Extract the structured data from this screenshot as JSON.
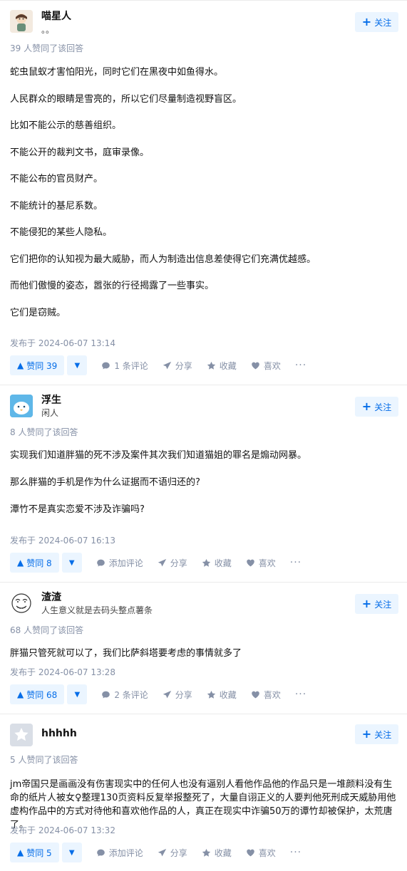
{
  "follow_label": "关注",
  "answers": [
    {
      "author": "喵星人",
      "bio": "。。",
      "vote_text": "39 人赞同了该回答",
      "paragraphs": [
        "蛇虫鼠蚁才害怕阳光，同时它们在黑夜中如鱼得水。",
        "人民群众的眼睛是雪亮的，所以它们尽量制造视野盲区。",
        "比如不能公示的慈善组织。",
        "不能公开的裁判文书，庭审录像。",
        "不能公布的官员财产。",
        "不能统计的基尼系数。",
        "不能侵犯的某些人隐私。",
        "它们把你的认知视为最大威胁，而人为制造出信息差使得它们充满优越感。",
        "而他们傲慢的姿态，嚣张的行径揭露了一些事实。",
        "它们是窃贼。"
      ],
      "time": "发布于 2024-06-07 13:14",
      "upvote": "赞同 39",
      "comment": "1 条评论",
      "share": "分享",
      "collect": "收藏",
      "like": "喜欢",
      "more": "···"
    },
    {
      "author": "浮生",
      "bio": "闲人",
      "vote_text": "8 人赞同了该回答",
      "paragraphs": [
        "实现我们知道胖猫的死不涉及案件其次我们知道猫姐的罪名是煽动网暴。",
        "那么胖猫的手机是作为什么证据而不语归还的?",
        "潭竹不是真实恋爱不涉及诈骗吗?"
      ],
      "time": "发布于 2024-06-07 16:13",
      "upvote": "赞同 8",
      "comment": "添加评论",
      "share": "分享",
      "collect": "收藏",
      "like": "喜欢",
      "more": "···"
    },
    {
      "author": "渣渣",
      "bio": "人生意义就是去码头整点薯条",
      "vote_text": "68 人赞同了该回答",
      "paragraphs": [
        "胖猫只管死就可以了，我们比萨斜塔要考虑的事情就多了"
      ],
      "time": "发布于 2024-06-07 13:28",
      "upvote": "赞同 68",
      "comment": "2 条评论",
      "share": "分享",
      "collect": "收藏",
      "like": "喜欢",
      "more": "···"
    },
    {
      "author": "hhhhh",
      "bio": "",
      "vote_text": "5 人赞同了该回答",
      "paragraphs": [
        "jm帝国只是画画没有伤害现实中的任何人也没有逼别人看他作品他的作品只是一堆颜料没有生命的纸片人被女♀整理130页资料反复举报整死了，大量自诩正义的人要判他死刑成天威胁用他虚构作品中的方式对待他和喜欢他作品的人，真正在现实中诈骗50万的谭竹却被保护，太荒唐了。"
      ],
      "time": "发布于 2024-06-07 13:32",
      "upvote": "赞同 5",
      "comment": "添加评论",
      "share": "分享",
      "collect": "收藏",
      "like": "喜欢",
      "more": "···"
    }
  ]
}
